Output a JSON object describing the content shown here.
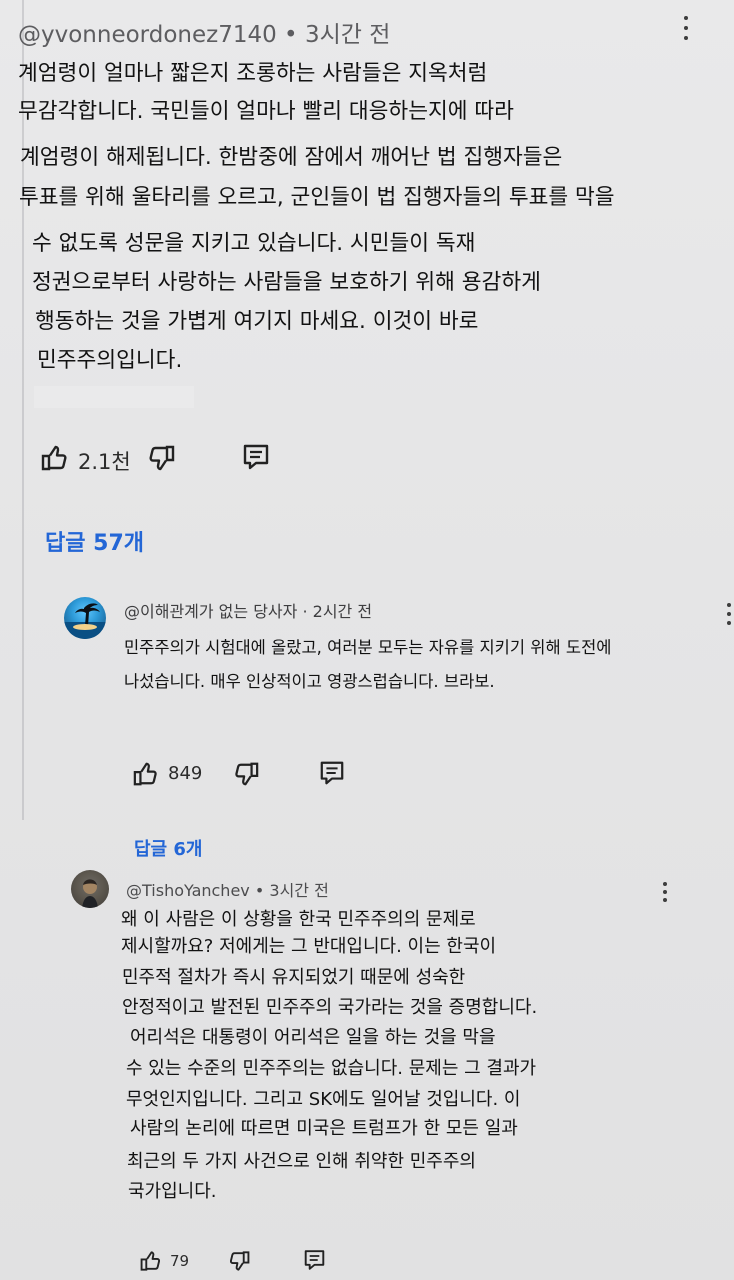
{
  "comment": {
    "author": "@yvonneordonez7140",
    "time": "3시간 전",
    "lines": [
      "계엄령이 얼마나 짧은지 조롱하는 사람들은 지옥처럼",
      "무감각합니다. 국민들이 얼마나 빨리 대응하는지에 따라",
      "계엄령이 해제됩니다. 한밤중에 잠에서 깨어난 법 집행자들은",
      "투표를 위해 울타리를 오르고, 군인들이 법 집행자들의 투표를 막을",
      "수 없도록 성문을 지키고 있습니다. 시민들이 독재",
      "정권으로부터 사랑하는 사람들을 보호하기 위해 용감하게",
      "행동하는 것을 가볍게 여기지 마세요. 이것이 바로",
      "민주주의입니다."
    ],
    "likes": "2.1천",
    "replies": "답글 57개"
  },
  "reply1": {
    "author": "@이해관계가 없는 당사자",
    "time": "2시간 전",
    "lines": [
      "민주주의가 시험대에 올랐고, 여러분 모두는 자유를 지키기 위해 도전에",
      "나섰습니다. 매우 인상적이고 영광스럽습니다. 브라보."
    ],
    "likes": "849",
    "replies": "답글 6개"
  },
  "reply2": {
    "author": "@TishoYanchev",
    "time": "3시간 전",
    "lines": [
      "왜 이 사람은 이 상황을 한국 민주주의의 문제로",
      "제시할까요? 저에게는 그 반대입니다. 이는 한국이",
      "민주적 절차가 즉시 유지되었기 때문에 성숙한",
      "안정적이고 발전된 민주주의 국가라는 것을 증명합니다.",
      "어리석은 대통령이 어리석은 일을 하는 것을 막을",
      "수 있는 수준의 민주주의는 없습니다. 문제는 그 결과가",
      "무엇인지입니다. 그리고 SK에도 일어날 것입니다. 이",
      "사람의 논리에 따르면 미국은 트럼프가 한 모든 일과",
      "최근의 두 가지 사건으로 인해 취약한 민주주의",
      "국가입니다."
    ],
    "likes": "79"
  },
  "icons": {
    "like": "thumb-up-icon",
    "dislike": "thumb-down-icon",
    "reply": "comment-icon",
    "menu": "more-vert-icon"
  },
  "colors": {
    "accent": "#2366d6",
    "meta": "#5d5d60",
    "text": "#121212"
  }
}
